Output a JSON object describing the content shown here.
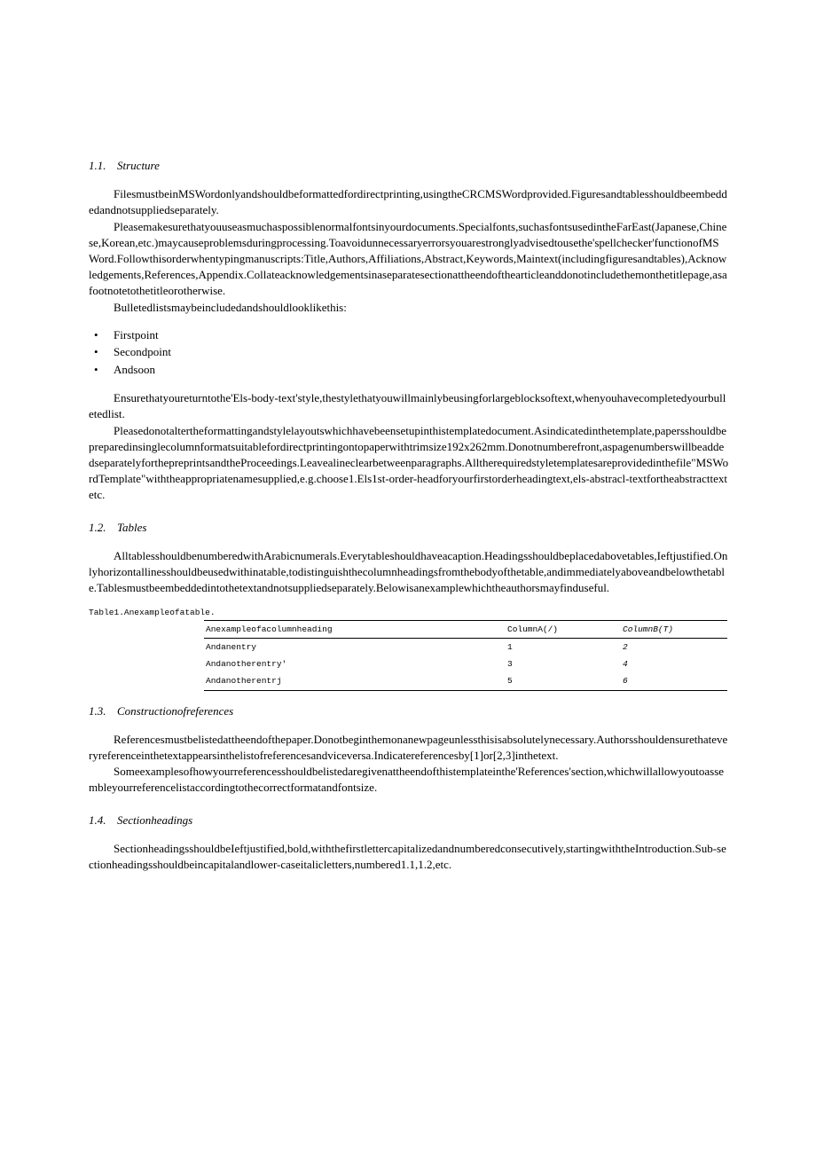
{
  "sections": {
    "s11": {
      "num": "1.1.",
      "title": "Structure",
      "p1": "FilesmustbeinMSWordonlyandshouldbeformattedfordirectprinting,usingtheCRCMSWordprovided.Figuresandtablesshouldbeembeddedandnotsuppliedseparately.",
      "p2": "Pleasemakesurethatyouuseasmuchaspossiblenormalfontsinyourdocuments.Specialfonts,suchasfontsusedintheFarEast(Japanese,Chinese,Korean,etc.)maycauseproblemsduringprocessing.Toavoidunnecessaryerrorsyouarestronglyadvisedtousethe'spellchecker'functionofMSWord.Followthisorderwhentypingmanuscripts:Title,Authors,Affiliations,Abstract,Keywords,Maintext(includingfiguresandtables),Acknowledgements,References,Appendix.Collateacknowledgementsinaseparatesectionattheendofthearticleanddonotincludethemonthetitlepage,asafootnotetothetitleorotherwise.",
      "p3": "Bulletedlistsmaybeincludedandshouldlooklikethis:",
      "bullets": [
        "Firstpoint",
        "Secondpoint",
        "Andsoon"
      ],
      "p4": "Ensurethatyoureturntothe'Els-body-text'style,thestylethatyouwillmainlybeusingforlargeblocksoftext,whenyouhavecompletedyourbulletedlist.",
      "p5": "Pleasedonotaltertheformattingandstylelayoutswhichhavebeensetupinthistemplatedocument.Asindicatedinthetemplate,papersshouldbepreparedinsinglecolumnformatsuitablefordirectprintingontopaperwithtrimsize192x262mm.Donotnumberefront,aspagenumberswillbeaddedseparatelyforthepreprintsandtheProceedings.Leavealineclearbetweenparagraphs.Alltherequiredstyletemplatesareprovidedinthefile\"MSWordTemplate\"withtheappropriatenamesupplied,e.g.choose1.Els1st-order-headforyourfirstorderheadingtext,els-abstracl-textfortheabstracttextetc."
    },
    "s12": {
      "num": "1.2.",
      "title": "Tables",
      "p1": "AlltablesshouldbenumberedwithArabicnumerals.Everytableshouldhaveacaption.Headingsshouldbeplacedabovetables,Ieftjustified.Onlyhorizontallinesshouldbeusedwithinatable,todistinguishthecolumnheadingsfromthebodyofthetable,andimmediatelyaboveandbelowthetable.Tablesmustbeembeddedintothetextandnotsuppliedseparately.Belowisanexamplewhichtheauthorsmayfinduseful."
    },
    "table": {
      "caption": "Table1.Anexampleofatable.",
      "headers": [
        "Anexampleofacolumnheading",
        "ColumnA(/)",
        "ColumnB(T)"
      ],
      "rows": [
        [
          "Andanentry",
          "1",
          "2"
        ],
        [
          "Andanotherentry'",
          "3",
          "4"
        ],
        [
          "Andanotherentrj",
          "5",
          "6"
        ]
      ]
    },
    "s13": {
      "num": "1.3.",
      "title": "Constructionofreferences",
      "p1": "Referencesmustbelistedattheendofthepaper.Donotbeginthemonanewpageunlessthisisabsolutelynecessary.Authorsshouldensurethateveryreferenceinthetextappearsinthelistofreferencesandviceversa.Indicatereferencesby[1]or[2,3]inthetext.",
      "p2": "Someexamplesofhowyourreferencesshouldbelistedaregivenattheendofthistemplateinthe'References'section,whichwillallowyoutoassembleyourreferencelistaccordingtothecorrectformatandfontsize."
    },
    "s14": {
      "num": "1.4.",
      "title": "Sectionheadings",
      "p1": "SectionheadingsshouldbeIeftjustified,bold,withthefirstlettercapitalizedandnumberedconsecutively,startingwiththeIntroduction.Sub-sectionheadingsshouldbeincapitalandlower-caseitalicletters,numbered1.1,1.2,etc."
    }
  }
}
